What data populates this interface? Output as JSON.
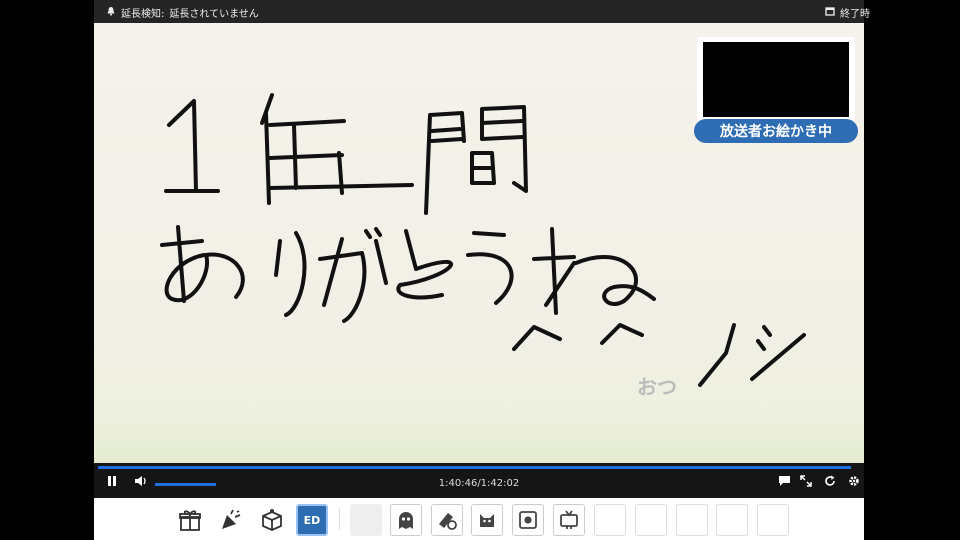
{
  "topbar": {
    "extension_label": "延長検知:",
    "extension_status": "延長されていません",
    "end_label": "終了時",
    "bell_icon": "bell-icon",
    "calendar_icon": "calendar-icon"
  },
  "video": {
    "drawing_line1": "1年間",
    "drawing_line2": "ありがとうね",
    "drawing_line3": "^^ノシ",
    "stamp": "おつ",
    "cam_badge": "放送者お絵かき中"
  },
  "controls": {
    "time": "1:40:46/1:42:02",
    "progress": 0.988,
    "volume": 0.35
  },
  "colors": {
    "accent": "#1f6fe0",
    "badge": "#2e6db4"
  },
  "toolbar": {
    "ed_label": "ED",
    "icons": [
      "gift-icon",
      "party-popper-icon",
      "box-icon",
      "ed-icon",
      "blank-icon",
      "ghost-icon",
      "eraser-icon",
      "cat-icon",
      "record-icon",
      "tv-icon"
    ]
  }
}
